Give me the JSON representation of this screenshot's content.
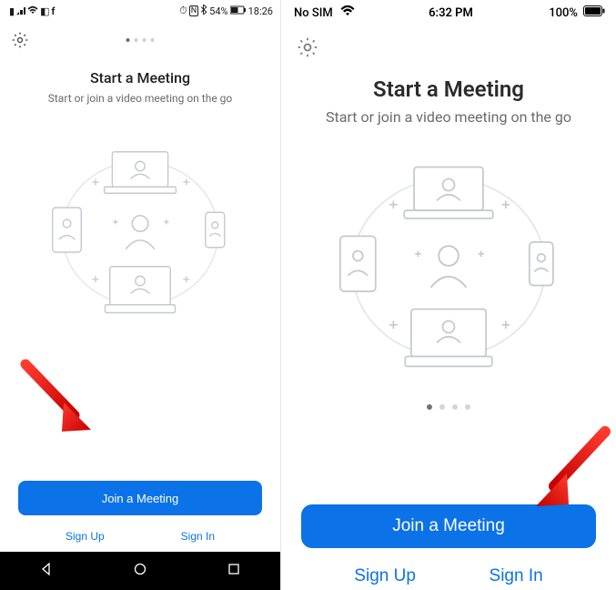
{
  "left": {
    "statusbar": {
      "op_icons": [
        "volte-icon",
        "signal-icon",
        "wifi-icon",
        "social1-icon",
        "fb-icon"
      ],
      "right_icons": [
        "alarm-icon",
        "nfc-icon",
        "bt-icon"
      ],
      "battery_pct": "54%",
      "time": "18:26"
    },
    "title": "Start a Meeting",
    "subtitle": "Start or join a video meeting on the go",
    "page_dots": {
      "count": 4,
      "active": 0
    },
    "join_btn": "Join a Meeting",
    "signup": "Sign Up",
    "signin": "Sign In"
  },
  "right": {
    "statusbar": {
      "sim": "No SIM",
      "time": "6:32 PM",
      "battery_pct": "100%"
    },
    "title": "Start a Meeting",
    "subtitle": "Start or join a video meeting on the go",
    "page_dots": {
      "count": 4,
      "active": 0
    },
    "join_btn": "Join a Meeting",
    "signup": "Sign Up",
    "signin": "Sign In"
  },
  "colors": {
    "primary": "#0b72e7",
    "muted": "#6b6b6b"
  }
}
